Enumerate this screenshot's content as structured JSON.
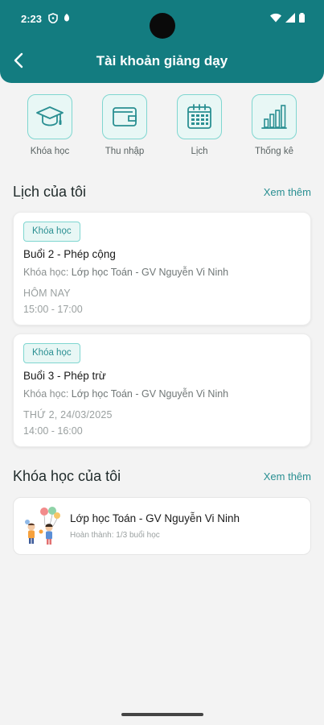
{
  "status": {
    "time": "2:23"
  },
  "header": {
    "title": "Tài khoản giảng dạy"
  },
  "quick_actions": [
    {
      "label": "Khóa học",
      "icon": "graduation-cap-icon"
    },
    {
      "label": "Thu nhập",
      "icon": "wallet-icon"
    },
    {
      "label": "Lịch",
      "icon": "calendar-icon"
    },
    {
      "label": "Thống kê",
      "icon": "bar-chart-icon"
    }
  ],
  "schedule": {
    "title": "Lịch của tôi",
    "more": "Xem thêm",
    "items": [
      {
        "badge": "Khóa học",
        "title": "Buổi 2 - Phép cộng",
        "course_label": "Khóa học:",
        "course_value": "Lớp học Toán - GV Nguyễn Vi Ninh",
        "date": "HÔM NAY",
        "time": "15:00 - 17:00"
      },
      {
        "badge": "Khóa học",
        "title": "Buổi 3 - Phép trừ",
        "course_label": "Khóa học:",
        "course_value": "Lớp học Toán - GV Nguyễn Vi Ninh",
        "date": "THỨ 2, 24/03/2025",
        "time": "14:00 - 16:00"
      }
    ]
  },
  "courses": {
    "title": "Khóa học của tôi",
    "more": "Xem thêm",
    "items": [
      {
        "name": "Lớp học Toán - GV Nguyễn Vi Ninh",
        "progress": "Hoàn thành: 1/3 buổi học"
      }
    ]
  },
  "colors": {
    "primary": "#137c80",
    "accent": "#2a8f92",
    "icon_bg": "#e8f7f5",
    "icon_border": "#7fd6d0"
  }
}
